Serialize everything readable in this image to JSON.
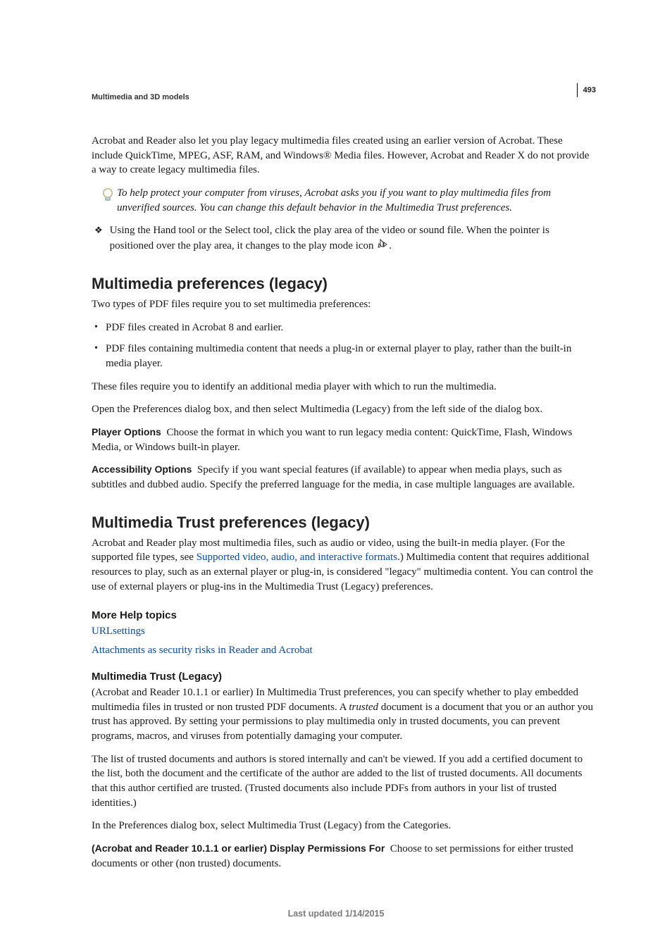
{
  "page_number": "493",
  "header_crumb": "Multimedia and 3D models",
  "intro_para": "Acrobat and Reader also let you play legacy multimedia files created using an earlier version of Acrobat. These include QuickTime, MPEG, ASF, RAM, and Windows® Media files. However, Acrobat and Reader X do not provide a way to create legacy multimedia files.",
  "tip_text": "To help protect your computer from viruses, Acrobat asks you if you want to play multimedia files from unverified sources. You can change this default behavior in the Multimedia Trust preferences.",
  "diamond_text_before": "Using the Hand tool or the Select tool, click the play area of the video or sound file. When the pointer is positioned over the play area, it changes to the play mode icon ",
  "diamond_text_after": ".",
  "section1": {
    "title": "Multimedia preferences (legacy)",
    "lead": "Two types of PDF files require you to set multimedia preferences:",
    "bullets": [
      "PDF files created in Acrobat 8 and earlier.",
      "PDF files containing multimedia content that needs a plug-in or external player to play, rather than the built-in media player."
    ],
    "p1": "These files require you to identify an additional media player with which to run the multimedia.",
    "p2": "Open the Preferences dialog box, and then select Multimedia (Legacy) from the left side of the dialog box.",
    "opt1_label": "Player Options",
    "opt1_text": "Choose the format in which you want to run legacy media content: QuickTime, Flash, Windows Media, or Windows built-in player.",
    "opt2_label": "Accessibility Options",
    "opt2_text": "Specify if you want special features (if available) to appear when media plays, such as subtitles and dubbed audio. Specify the preferred language for the media, in case multiple languages are available."
  },
  "section2": {
    "title": "Multimedia Trust preferences (legacy)",
    "p1_before": "Acrobat and Reader play most multimedia files, such as audio or video, using the built-in media player. (For the supported file types, see ",
    "p1_link": "Supported video, audio, and interactive formats",
    "p1_after": ".) Multimedia content that requires additional resources to play, such as an external player or plug-in, is considered \"legacy\" multimedia content. You can control the use of external players or plug-ins in the Multimedia Trust (Legacy) preferences.",
    "more_help_heading": "More Help topics",
    "link1": "URLsettings",
    "link2": "Attachments as security risks in Reader and Acrobat",
    "sub_heading": "Multimedia Trust (Legacy)",
    "sub_p1_before": "(Acrobat and Reader 10.1.1 or earlier) In Multimedia Trust preferences, you can specify whether to play embedded multimedia files in trusted or non trusted PDF documents. A ",
    "sub_p1_ital": "trusted",
    "sub_p1_after": " document is a document that you or an author you trust has approved. By setting your permissions to play multimedia only in trusted documents, you can prevent programs, macros, and viruses from potentially damaging your computer.",
    "sub_p2": "The list of trusted documents and authors is stored internally and can't be viewed. If you add a certified document to the list, both the document and the certificate of the author are added to the list of trusted documents. All documents that this author certified are trusted. (Trusted documents also include PDFs from authors in your list of trusted identities.)",
    "sub_p3": "In the Preferences dialog box, select Multimedia Trust (Legacy) from the Categories.",
    "opt_label": "(Acrobat and Reader 10.1.1 or earlier) Display Permissions For",
    "opt_text": "Choose to set permissions for either trusted documents or other (non trusted) documents."
  },
  "footer": "Last updated 1/14/2015"
}
